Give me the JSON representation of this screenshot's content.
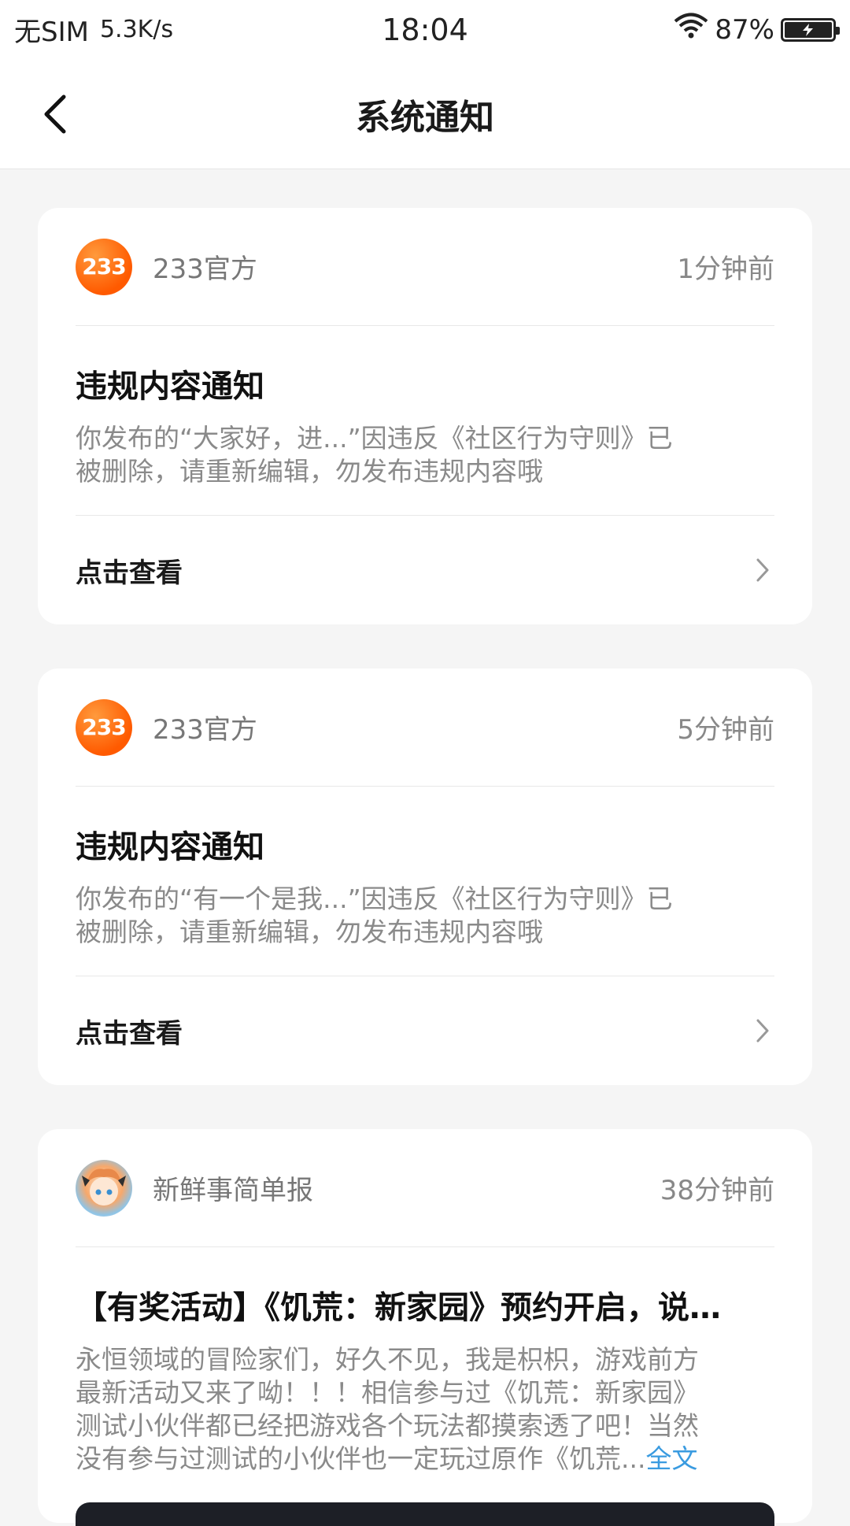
{
  "status_bar": {
    "carrier": "无SIM",
    "speed": "5.3K/s",
    "time": "18:04",
    "battery": "87%"
  },
  "header": {
    "title": "系统通知"
  },
  "notifications": [
    {
      "source": "233官方",
      "avatar_text": "233",
      "time": "1分钟前",
      "title": "违规内容通知",
      "body_line1": "你发布的“大家好，进...”因违反《社区行为守则》已",
      "body_line2": "被删除，请重新编辑，勿发布违规内容哦",
      "action": "点击查看"
    },
    {
      "source": "233官方",
      "avatar_text": "233",
      "time": "5分钟前",
      "title": "违规内容通知",
      "body_line1": "你发布的“有一个是我...”因违反《社区行为守则》已",
      "body_line2": "被删除，请重新编辑，勿发布违规内容哦",
      "action": "点击查看"
    },
    {
      "source": "新鲜事简单报",
      "time": "38分钟前",
      "title": "【有奖活动】《饥荒：新家园》预约开启，说…",
      "body_line1": "永恒领域的冒险家们，好久不见，我是枳枳，游戏前方",
      "body_line2": "最新活动又来了呦！！！相信参与过《饥荒：新家园》",
      "body_line3": "测试小伙伴都已经把游戏各个玩法都摸索透了吧！当然",
      "body_line4": "没有参与过测试的小伙伴也一定玩过原作《饥荒...",
      "read_more": "全文"
    }
  ]
}
